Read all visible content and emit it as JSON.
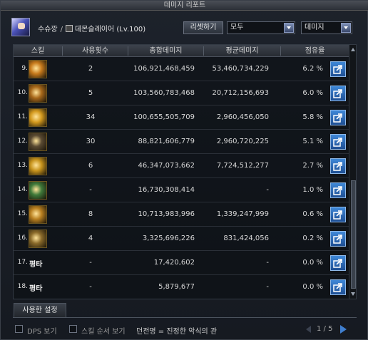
{
  "window": {
    "title": "데미지 리포트"
  },
  "header": {
    "character_name": "수슈깡",
    "separator": "/",
    "class_level": "데몬슬레이어 (Lv.100)",
    "reset_label": "리셋하기",
    "filter_value": "모두",
    "type_value": "데미지"
  },
  "columns": {
    "skill": "스킬",
    "uses": "사용횟수",
    "total": "총합데미지",
    "avg": "평균데미지",
    "share": "점유율"
  },
  "rows": [
    {
      "num": "9.",
      "skill_text": "",
      "icon_color": "#c77a1c",
      "uses": "2",
      "total": "106,921,468,459",
      "avg": "53,460,734,229",
      "share": "6.2 %"
    },
    {
      "num": "10.",
      "skill_text": "",
      "icon_color": "#a8681a",
      "uses": "5",
      "total": "103,560,783,468",
      "avg": "20,712,156,693",
      "share": "6.0 %"
    },
    {
      "num": "11.",
      "skill_text": "",
      "icon_color": "#d49a1e",
      "uses": "34",
      "total": "100,655,505,709",
      "avg": "2,960,456,050",
      "share": "5.8 %"
    },
    {
      "num": "12.",
      "skill_text": "",
      "icon_color": "#5a4a32",
      "uses": "30",
      "total": "88,821,606,779",
      "avg": "2,960,720,225",
      "share": "5.1 %"
    },
    {
      "num": "13.",
      "skill_text": "",
      "icon_color": "#c7931c",
      "uses": "6",
      "total": "46,347,073,662",
      "avg": "7,724,512,277",
      "share": "2.7 %"
    },
    {
      "num": "14.",
      "skill_text": "",
      "icon_color": "#3f7a3a",
      "uses": "-",
      "total": "16,730,308,414",
      "avg": "-",
      "share": "1.0 %"
    },
    {
      "num": "15.",
      "skill_text": "",
      "icon_color": "#b98020",
      "uses": "8",
      "total": "10,713,983,996",
      "avg": "1,339,247,999",
      "share": "0.6 %"
    },
    {
      "num": "16.",
      "skill_text": "",
      "icon_color": "#8a6a2a",
      "uses": "4",
      "total": "3,325,696,226",
      "avg": "831,424,056",
      "share": "0.2 %"
    },
    {
      "num": "17.",
      "skill_text": "평타",
      "icon_color": "",
      "uses": "-",
      "total": "17,420,602",
      "avg": "-",
      "share": "0.0 %"
    },
    {
      "num": "18.",
      "skill_text": "평타",
      "icon_color": "",
      "uses": "-",
      "total": "5,879,677",
      "avg": "-",
      "share": "0.0 %"
    }
  ],
  "tabs": {
    "used_settings": "사용한 설정"
  },
  "footer": {
    "dps_label": "DPS 보기",
    "order_label": "스킬 순서 보기",
    "title_line": "던전명 = 진정한 악식의 관",
    "page": "1 / 5"
  },
  "colors": {
    "accent_blue": "#3f88d8",
    "header_bg": "#2c3037"
  }
}
